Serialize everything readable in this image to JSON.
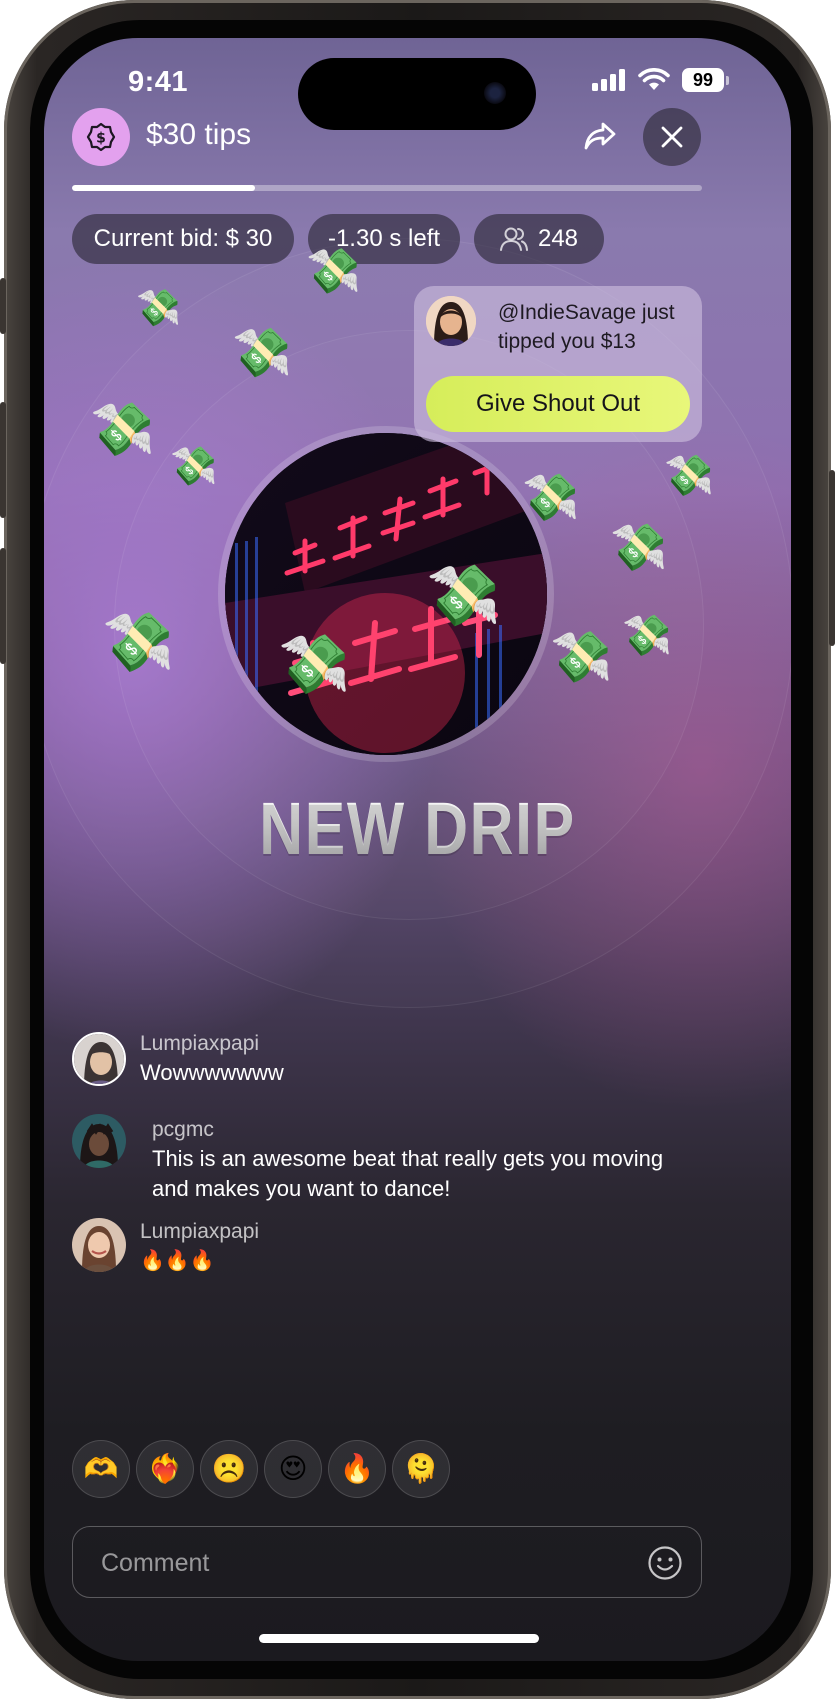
{
  "status_bar": {
    "time": "9:41",
    "battery": "99"
  },
  "header": {
    "tips_label": "$30 tips",
    "icons": {
      "tips": "dollar-coin-icon",
      "share": "share-arrow-icon",
      "close": "close-icon"
    },
    "progress_fraction": 0.29
  },
  "stats": {
    "current_bid": "Current bid: $ 30",
    "time_left": "-1.30 s left",
    "viewers": "248"
  },
  "notification": {
    "message": "@IndieSavage just tipped you $13",
    "button_label": "Give Shout Out"
  },
  "track": {
    "title": "NEW DRIP"
  },
  "comments": [
    {
      "user": "Lumpiaxpapi",
      "text": "Wowwwwwww"
    },
    {
      "user": "pcgmc",
      "text": "This is an awesome beat that really gets you moving and makes you want to dance!"
    },
    {
      "user": "Lumpiaxpapi",
      "text": "🔥🔥🔥"
    }
  ],
  "reactions": [
    "🫶",
    "❤️‍🔥",
    "☹️",
    "😍",
    "🔥",
    "🫠"
  ],
  "comment_input": {
    "placeholder": "Comment"
  },
  "colors": {
    "accent_pink": "#e3a1ee",
    "shout_button": "#d6ed5a"
  }
}
